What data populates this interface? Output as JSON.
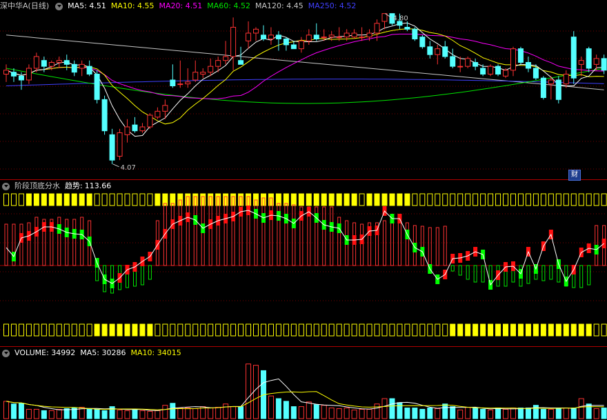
{
  "main_header": {
    "stock_name": "深中华A(日线)",
    "ma5": "MA5: 4.51",
    "ma10": "MA10: 4.55",
    "ma20": "MA20: 4.51",
    "ma60": "MA60: 4.52",
    "ma120": "MA120: 4.45",
    "ma250": "MA250: 4.52"
  },
  "indicator_header": {
    "name": "阶段顶底分水",
    "trend_label": "趋势:",
    "trend_value": "113.66"
  },
  "volume_header": {
    "volume": "VOLUME: 34992",
    "ma5": "MA5: 30286",
    "ma10": "MA10: 34015"
  },
  "badge": "财",
  "colors": {
    "up": "#ff3232",
    "down": "#54ffff",
    "ma5": "#ffffff",
    "ma10": "#ffff00",
    "ma20": "#ff00ff",
    "ma60": "#00e600",
    "ma120": "#c8c8c8",
    "ma250": "#4040ff",
    "grid": "#7a0000",
    "band": "#ffff00"
  },
  "chart_data": [
    {
      "type": "candlestick",
      "ylim": [
        4.02,
        4.86
      ],
      "high_label": "4.80",
      "low_label": "4.07",
      "candles": [
        [
          4.53,
          4.58,
          4.49,
          4.55
        ],
        [
          4.54,
          4.56,
          4.49,
          4.52
        ],
        [
          4.52,
          4.54,
          4.45,
          4.5
        ],
        [
          4.5,
          4.58,
          4.48,
          4.56
        ],
        [
          4.56,
          4.64,
          4.54,
          4.62
        ],
        [
          4.6,
          4.62,
          4.54,
          4.57
        ],
        [
          4.57,
          4.6,
          4.55,
          4.59
        ],
        [
          4.59,
          4.62,
          4.56,
          4.6
        ],
        [
          4.6,
          4.63,
          4.55,
          4.58
        ],
        [
          4.58,
          4.6,
          4.52,
          4.54
        ],
        [
          4.56,
          4.6,
          4.52,
          4.58
        ],
        [
          4.57,
          4.6,
          4.52,
          4.53
        ],
        [
          4.53,
          4.55,
          4.38,
          4.4
        ],
        [
          4.4,
          4.42,
          4.22,
          4.24
        ],
        [
          4.22,
          4.25,
          4.07,
          4.09
        ],
        [
          4.11,
          4.25,
          4.09,
          4.23
        ],
        [
          4.22,
          4.3,
          4.18,
          4.26
        ],
        [
          4.27,
          4.31,
          4.23,
          4.24
        ],
        [
          4.24,
          4.28,
          4.23,
          4.26
        ],
        [
          4.26,
          4.33,
          4.25,
          4.32
        ],
        [
          4.31,
          4.36,
          4.3,
          4.34
        ],
        [
          4.34,
          4.4,
          4.3,
          4.37
        ],
        [
          4.5,
          4.58,
          4.46,
          4.47
        ],
        [
          4.48,
          4.6,
          4.46,
          4.48
        ],
        [
          4.48,
          4.56,
          4.46,
          4.49
        ],
        [
          4.5,
          4.6,
          4.49,
          4.54
        ],
        [
          4.53,
          4.56,
          4.51,
          4.54
        ],
        [
          4.54,
          4.61,
          4.52,
          4.57
        ],
        [
          4.57,
          4.62,
          4.54,
          4.6
        ],
        [
          4.6,
          4.7,
          4.58,
          4.62
        ],
        [
          4.62,
          4.82,
          4.55,
          4.77
        ],
        [
          4.6,
          4.67,
          4.58,
          4.58
        ],
        [
          4.7,
          4.8,
          4.66,
          4.74
        ],
        [
          4.74,
          4.77,
          4.7,
          4.76
        ],
        [
          4.73,
          4.78,
          4.7,
          4.71
        ],
        [
          4.71,
          4.77,
          4.68,
          4.73
        ],
        [
          4.73,
          4.75,
          4.65,
          4.71
        ],
        [
          4.71,
          4.72,
          4.65,
          4.68
        ],
        [
          4.68,
          4.7,
          4.66,
          4.66
        ],
        [
          4.66,
          4.72,
          4.64,
          4.7
        ],
        [
          4.7,
          4.76,
          4.68,
          4.73
        ],
        [
          4.73,
          4.79,
          4.7,
          4.71
        ],
        [
          4.72,
          4.76,
          4.7,
          4.72
        ],
        [
          4.72,
          4.75,
          4.7,
          4.73
        ],
        [
          4.72,
          4.77,
          4.7,
          4.72
        ],
        [
          4.72,
          4.76,
          4.7,
          4.74
        ],
        [
          4.72,
          4.76,
          4.71,
          4.74
        ],
        [
          4.72,
          4.77,
          4.7,
          4.72
        ],
        [
          4.72,
          4.76,
          4.7,
          4.74
        ],
        [
          4.74,
          4.81,
          4.7,
          4.79
        ],
        [
          4.8,
          4.84,
          4.76,
          4.84
        ],
        [
          4.84,
          4.84,
          4.78,
          4.79
        ],
        [
          4.8,
          4.84,
          4.76,
          4.78
        ],
        [
          4.77,
          4.8,
          4.75,
          4.76
        ],
        [
          4.76,
          4.77,
          4.7,
          4.71
        ],
        [
          4.72,
          4.73,
          4.66,
          4.67
        ],
        [
          4.67,
          4.7,
          4.61,
          4.63
        ],
        [
          4.63,
          4.68,
          4.58,
          4.66
        ],
        [
          4.67,
          4.7,
          4.61,
          4.62
        ],
        [
          4.62,
          4.66,
          4.56,
          4.57
        ],
        [
          4.57,
          4.62,
          4.54,
          4.57
        ],
        [
          4.57,
          4.62,
          4.56,
          4.61
        ],
        [
          4.59,
          4.61,
          4.55,
          4.57
        ],
        [
          4.56,
          4.58,
          4.52,
          4.53
        ],
        [
          4.53,
          4.58,
          4.52,
          4.57
        ],
        [
          4.57,
          4.58,
          4.52,
          4.53
        ],
        [
          4.52,
          4.56,
          4.51,
          4.55
        ],
        [
          4.55,
          4.67,
          4.52,
          4.66
        ],
        [
          4.66,
          4.67,
          4.58,
          4.59
        ],
        [
          4.59,
          4.62,
          4.54,
          4.56
        ],
        [
          4.56,
          4.58,
          4.5,
          4.51
        ],
        [
          4.51,
          4.52,
          4.4,
          4.41
        ],
        [
          4.48,
          4.52,
          4.4,
          4.5
        ],
        [
          4.5,
          4.52,
          4.38,
          4.4
        ],
        [
          4.48,
          4.55,
          4.46,
          4.53
        ],
        [
          4.72,
          4.75,
          4.48,
          4.51
        ],
        [
          4.58,
          4.62,
          4.52,
          4.6
        ],
        [
          4.66,
          4.67,
          4.54,
          4.56
        ],
        [
          4.58,
          4.63,
          4.55,
          4.61
        ],
        [
          4.61,
          4.63,
          4.53,
          4.55
        ]
      ]
    },
    {
      "type": "bar",
      "trend_line": [
        56,
        43,
        70,
        73,
        79,
        86,
        86,
        83,
        78,
        76,
        75,
        65,
        34,
        10,
        4,
        12,
        24,
        28,
        36,
        43,
        60,
        76,
        90,
        95,
        100,
        96,
        84,
        90,
        95,
        98,
        101,
        108,
        110,
        105,
        99,
        103,
        102,
        98,
        91,
        102,
        108,
        99,
        89,
        86,
        84,
        67,
        67,
        68,
        80,
        81,
        109,
        98,
        98,
        75,
        56,
        50,
        25,
        10,
        17,
        40,
        41,
        44,
        50,
        46,
        2,
        16,
        28,
        29,
        18,
        50,
        25,
        58,
        75,
        32,
        7,
        24,
        49,
        55,
        53,
        62
      ],
      "pos_bars": [
        60,
        60,
        60,
        62,
        70,
        67,
        67,
        70,
        67,
        67,
        70,
        65,
        0,
        0,
        0,
        0,
        0,
        0,
        0,
        0,
        65,
        90,
        90,
        95,
        100,
        100,
        100,
        100,
        100,
        100,
        100,
        100,
        100,
        95,
        98,
        98,
        90,
        90,
        88,
        85,
        85,
        85,
        85,
        85,
        70,
        65,
        62,
        60,
        62,
        62,
        65,
        65,
        62,
        62,
        58,
        57,
        55,
        55,
        57,
        0,
        0,
        0,
        0,
        0,
        0,
        0,
        0,
        0,
        0,
        0,
        0,
        0,
        0,
        0,
        0,
        0,
        0,
        0,
        58,
        58
      ],
      "neg_bars": [
        0,
        0,
        0,
        0,
        0,
        0,
        0,
        0,
        0,
        0,
        0,
        0,
        -22,
        -38,
        -40,
        -35,
        -32,
        -30,
        -28,
        -20,
        0,
        0,
        0,
        0,
        0,
        0,
        0,
        0,
        0,
        0,
        0,
        0,
        0,
        0,
        0,
        0,
        0,
        0,
        0,
        0,
        0,
        0,
        0,
        0,
        0,
        0,
        0,
        0,
        0,
        0,
        0,
        0,
        0,
        0,
        0,
        0,
        0,
        0,
        0,
        -8,
        -14,
        -20,
        -24,
        -24,
        -30,
        -30,
        -30,
        -24,
        -30,
        -26,
        -20,
        -22,
        -20,
        -24,
        -30,
        -32,
        -32,
        -28,
        0,
        0
      ]
    },
    {
      "type": "bar",
      "ylim": [
        0,
        90000
      ],
      "values": [
        26000,
        22000,
        23000,
        14000,
        14000,
        12000,
        12000,
        14000,
        15000,
        16000,
        17000,
        14000,
        14000,
        12000,
        18000,
        13000,
        12000,
        14000,
        12000,
        11000,
        12000,
        20000,
        23000,
        16000,
        16000,
        15000,
        18000,
        16000,
        17000,
        22000,
        18000,
        18000,
        82000,
        80000,
        72000,
        34000,
        30000,
        26000,
        18000,
        18000,
        25000,
        21000,
        20000,
        16000,
        15000,
        16000,
        13000,
        14000,
        14000,
        22000,
        30000,
        30000,
        24000,
        16000,
        16000,
        14000,
        16000,
        15000,
        22000,
        18000,
        13000,
        17000,
        16000,
        14000,
        13000,
        16000,
        14000,
        16000,
        16000,
        16000,
        20000,
        14000,
        14000,
        16000,
        16000,
        16000,
        30000,
        22000,
        15000,
        16000
      ]
    }
  ]
}
